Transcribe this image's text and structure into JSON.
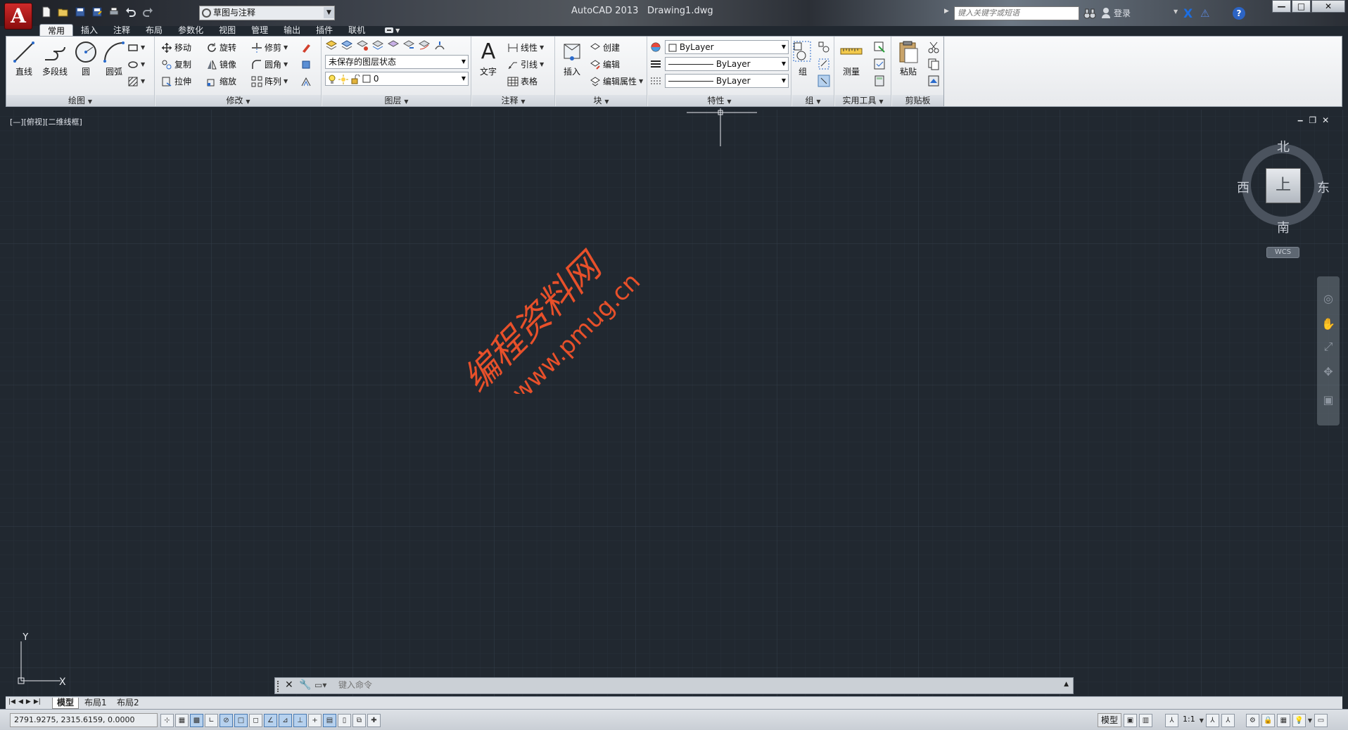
{
  "window": {
    "app_title": "AutoCAD 2013",
    "doc_title": "Drawing1.dwg",
    "app_menu_letter": "A"
  },
  "workspace": {
    "value": "草图与注释"
  },
  "search": {
    "placeholder": "键入关键字或短语"
  },
  "user": {
    "login_label": "登录"
  },
  "tabs": [
    "常用",
    "插入",
    "注释",
    "布局",
    "参数化",
    "视图",
    "管理",
    "输出",
    "插件",
    "联机"
  ],
  "ribbon": {
    "draw": {
      "title": "绘图",
      "line": "直线",
      "polyline": "多段线",
      "circle": "圆",
      "arc": "圆弧"
    },
    "modify": {
      "title": "修改",
      "move": "移动",
      "rotate": "旋转",
      "trim": "修剪",
      "copy": "复制",
      "mirror": "镜像",
      "fillet": "圆角",
      "stretch": "拉伸",
      "scale": "缩放",
      "array": "阵列"
    },
    "layers": {
      "title": "图层",
      "state": "未保存的图层状态",
      "current": "0"
    },
    "annotation": {
      "title": "注释",
      "text": "文字",
      "dimension": "线性",
      "leader": "引线",
      "table": "表格"
    },
    "block": {
      "title": "块",
      "insert": "插入",
      "create": "创建",
      "edit": "编辑",
      "edit_attr": "编辑属性"
    },
    "properties": {
      "title": "特性",
      "color": "ByLayer",
      "linetype": "ByLayer",
      "lineweight": "ByLayer"
    },
    "groups": {
      "title": "组",
      "group": "组"
    },
    "utilities": {
      "title": "实用工具",
      "measure": "测量"
    },
    "clipboard": {
      "title": "剪贴板",
      "paste": "粘贴"
    }
  },
  "viewport": {
    "label": "[—][俯视][二维线框]"
  },
  "viewcube": {
    "north": "北",
    "south": "南",
    "east": "东",
    "west": "西",
    "face": "上",
    "wcs": "WCS"
  },
  "ucs": {
    "x": "X",
    "y": "Y"
  },
  "watermark": {
    "line1": "编程资料网",
    "line2": "www.pmug.cn"
  },
  "command": {
    "placeholder": "键入命令"
  },
  "layout_tabs": {
    "model": "模型",
    "layout1": "布局1",
    "layout2": "布局2"
  },
  "status": {
    "coords": "2791.9275, 2315.6159, 0.0000",
    "model_space": "模型",
    "annotation_scale": "1:1"
  },
  "colors": {
    "canvas": "#212830",
    "accent": "#c9171e",
    "watermark": "#e8502a"
  }
}
